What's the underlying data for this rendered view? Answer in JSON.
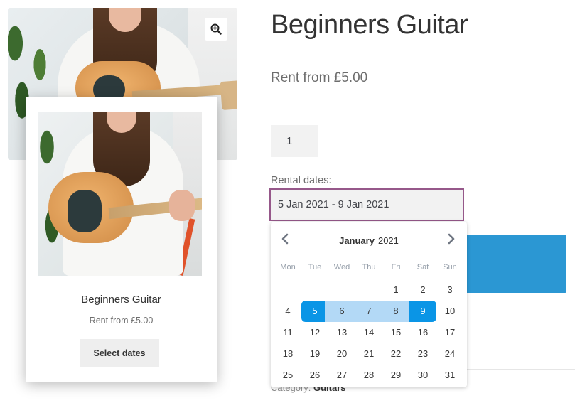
{
  "product": {
    "title": "Beginners Guitar",
    "price": "Rent from £5.00",
    "quantity": "1",
    "rental_label": "Rental dates:",
    "rental_value": "5 Jan 2021 - 9 Jan 2021",
    "category_label": "Category:",
    "category_link": "Guitars"
  },
  "card": {
    "title": "Beginners Guitar",
    "price": "Rent from £5.00",
    "button": "Select dates"
  },
  "calendar": {
    "month": "January",
    "year": "2021",
    "weekdays": [
      "Mon",
      "Tue",
      "Wed",
      "Thu",
      "Fri",
      "Sat",
      "Sun"
    ],
    "weeks": [
      [
        "",
        "",
        "",
        "",
        "1",
        "2",
        "3"
      ],
      [
        "4",
        "5",
        "6",
        "7",
        "8",
        "9",
        "10"
      ],
      [
        "11",
        "12",
        "13",
        "14",
        "15",
        "16",
        "17"
      ],
      [
        "18",
        "19",
        "20",
        "21",
        "22",
        "23",
        "24"
      ],
      [
        "25",
        "26",
        "27",
        "28",
        "29",
        "30",
        "31"
      ]
    ],
    "range_start": "5",
    "range_end": "9"
  },
  "icons": {
    "zoom": "zoom-in-icon",
    "prev": "chevron-left-icon",
    "next": "chevron-right-icon"
  },
  "colors": {
    "accent_range": "#0a95e6",
    "range_fill": "#b3d9f6",
    "input_border": "#96588a",
    "add_button": "#2b97d3"
  }
}
